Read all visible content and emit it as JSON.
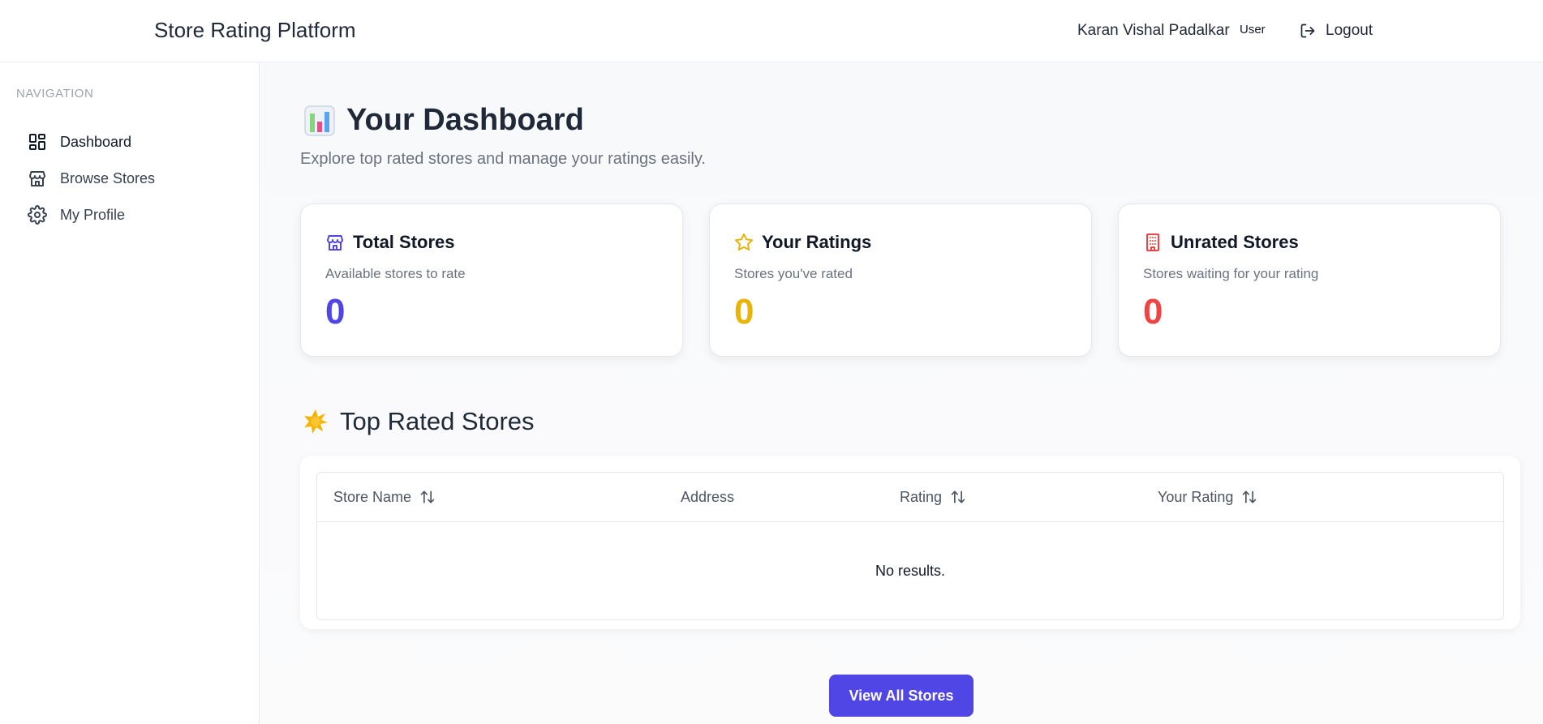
{
  "header": {
    "app_title": "Store Rating Platform",
    "user_name": "Karan Vishal Padalkar",
    "user_role": "User",
    "logout_label": "Logout",
    "logout_icon": "logout-icon"
  },
  "sidebar": {
    "heading": "NAVIGATION",
    "items": [
      {
        "label": "Dashboard",
        "icon": "dashboard-icon",
        "active": true
      },
      {
        "label": "Browse Stores",
        "icon": "store-icon",
        "active": false
      },
      {
        "label": "My Profile",
        "icon": "gear-icon",
        "active": false
      }
    ]
  },
  "main": {
    "title": "Your Dashboard",
    "title_icon": "bar-chart-emoji",
    "subtitle": "Explore top rated stores and manage your ratings easily.",
    "cards": [
      {
        "title": "Total Stores",
        "description": "Available stores to rate",
        "value": "0",
        "icon": "store-icon",
        "color": "#4f46e5"
      },
      {
        "title": "Your Ratings",
        "description": "Stores you've rated",
        "value": "0",
        "icon": "star-icon",
        "color": "#eab308"
      },
      {
        "title": "Unrated Stores",
        "description": "Stores waiting for your rating",
        "value": "0",
        "icon": "building-icon",
        "color": "#ef4444"
      }
    ],
    "section_title": "Top Rated Stores",
    "section_icon": "sparkle-emoji",
    "table": {
      "columns": [
        {
          "label": "Store Name",
          "sortable": true
        },
        {
          "label": "Address",
          "sortable": false
        },
        {
          "label": "Rating",
          "sortable": true
        },
        {
          "label": "Your Rating",
          "sortable": true
        }
      ],
      "empty_text": "No results."
    },
    "view_all_label": "View All Stores"
  },
  "colors": {
    "accent": "#4f46e5",
    "yellow": "#eab308",
    "red": "#ef4444"
  }
}
